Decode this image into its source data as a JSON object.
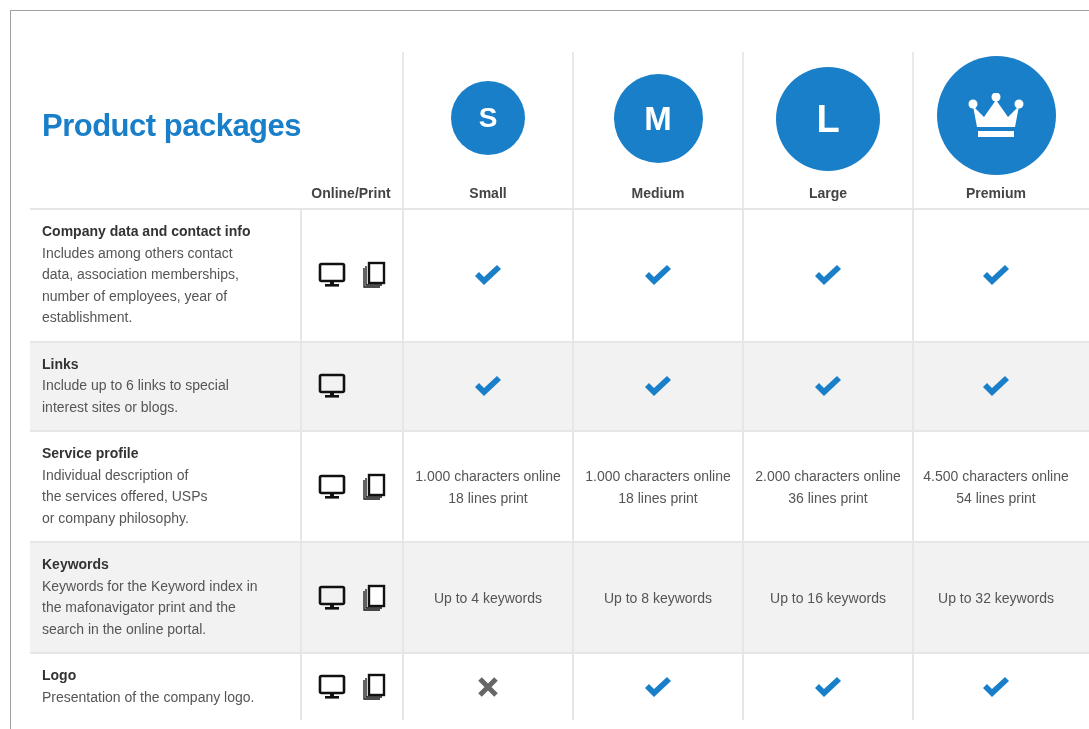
{
  "title": "Product packages",
  "media_column": "Online/Print",
  "packages": [
    {
      "kind": "letter",
      "letter": "S",
      "name": "Small"
    },
    {
      "kind": "letter",
      "letter": "M",
      "name": "Medium"
    },
    {
      "kind": "letter",
      "letter": "L",
      "name": "Large"
    },
    {
      "kind": "crown",
      "name": "Premium"
    }
  ],
  "rows": [
    {
      "title": "Company data and contact info",
      "description": "Includes among others contact data, association memberships, number of employees, year of establishment.",
      "online": true,
      "print": true,
      "cells": [
        {
          "kind": "check"
        },
        {
          "kind": "check"
        },
        {
          "kind": "check"
        },
        {
          "kind": "check"
        }
      ]
    },
    {
      "title": "Links",
      "description": "Include up to 6 links to special interest sites or blogs.",
      "online": true,
      "print": false,
      "cells": [
        {
          "kind": "check"
        },
        {
          "kind": "check"
        },
        {
          "kind": "check"
        },
        {
          "kind": "check"
        }
      ]
    },
    {
      "title": "Service profile",
      "description": "Individual description of\nthe services offered, USPs\nor company philosophy.",
      "online": true,
      "print": true,
      "cells": [
        {
          "kind": "text",
          "lines": [
            "1.000 characters online",
            "18 lines print"
          ]
        },
        {
          "kind": "text",
          "lines": [
            "1.000 characters online",
            "18 lines print"
          ]
        },
        {
          "kind": "text",
          "lines": [
            "2.000 characters online",
            "36 lines print"
          ]
        },
        {
          "kind": "text",
          "lines": [
            "4.500 characters online",
            "54 lines print"
          ]
        }
      ]
    },
    {
      "title": "Keywords",
      "description": "Keywords for the Keyword index in the mafonavigator print and the search in the online portal.",
      "online": true,
      "print": true,
      "cells": [
        {
          "kind": "text",
          "lines": [
            "Up to 4 keywords"
          ]
        },
        {
          "kind": "text",
          "lines": [
            "Up to 8 keywords"
          ]
        },
        {
          "kind": "text",
          "lines": [
            "Up to 16 keywords"
          ]
        },
        {
          "kind": "text",
          "lines": [
            "Up to 32 keywords"
          ]
        }
      ]
    },
    {
      "title": "Logo",
      "description": "Presentation of the company logo.",
      "online": true,
      "print": true,
      "cells": [
        {
          "kind": "cross"
        },
        {
          "kind": "check"
        },
        {
          "kind": "check"
        },
        {
          "kind": "check"
        }
      ]
    }
  ]
}
